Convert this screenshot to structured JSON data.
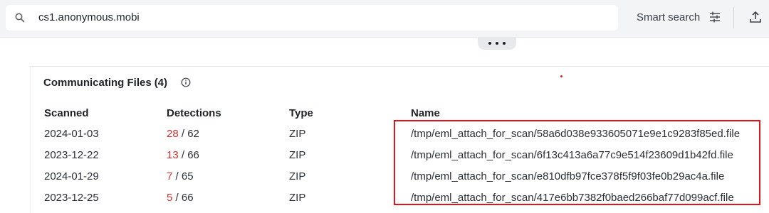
{
  "search": {
    "value": "cs1.anonymous.mobi",
    "smart_search_label": "Smart search"
  },
  "section": {
    "title": "Communicating Files",
    "count": "(4)"
  },
  "table": {
    "headers": [
      "Scanned",
      "Detections",
      "Type",
      "Name"
    ],
    "rows": [
      {
        "scanned": "2024-01-03",
        "detected": "28",
        "total": "/ 62",
        "type": "ZIP",
        "name": "/tmp/eml_attach_for_scan/58a6d038e933605071e9e1c9283f85ed.file"
      },
      {
        "scanned": "2023-12-22",
        "detected": "13",
        "total": "/ 66",
        "type": "ZIP",
        "name": "/tmp/eml_attach_for_scan/6f13c413a6a77c9e514f23609d1b42fd.file"
      },
      {
        "scanned": "2024-01-29",
        "detected": "7",
        "total": "/ 65",
        "type": "ZIP",
        "name": "/tmp/eml_attach_for_scan/e810dfb97fce378f5f9f03fe0b29ac4a.file"
      },
      {
        "scanned": "2023-12-25",
        "detected": "5",
        "total": "/ 66",
        "type": "ZIP",
        "name": "/tmp/eml_attach_for_scan/417e6bb7382f0baed266baf77d099acf.file"
      }
    ]
  },
  "colors": {
    "detection_red": "#d32f2f",
    "highlight_box": "#e3131b"
  },
  "icons": [
    "search-icon",
    "sliders-icon",
    "upload-icon",
    "info-icon",
    "more-icon"
  ]
}
